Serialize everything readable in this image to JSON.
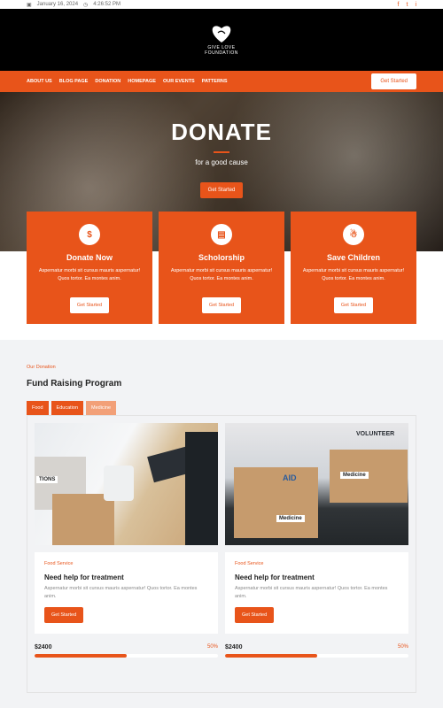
{
  "topbar": {
    "date": "January 16, 2024",
    "time": "4:26:52 PM",
    "social": [
      "f",
      "t",
      "i"
    ]
  },
  "brand": {
    "name": "GIVE LOVE",
    "tagline": "FOUNDATION"
  },
  "nav": {
    "items": [
      "ABOUT US",
      "BLOG PAGE",
      "DONATION",
      "HOMEPAGE",
      "OUR EVENTS",
      "PATTERNS"
    ],
    "cta": "Get Started"
  },
  "hero": {
    "title": "DONATE",
    "subtitle": "for a good cause",
    "cta": "Get Started"
  },
  "features": [
    {
      "icon": "$",
      "title": "Donate Now",
      "text": "Aspernatur morbi sit cursus mauris aspernatur! Quos tortor. Ea montes anim.",
      "cta": "Get Started"
    },
    {
      "icon": "▤",
      "title": "Scholorship",
      "text": "Aspernatur morbi sit cursus mauris aspernatur! Quos tortor. Ea montes anim.",
      "cta": "Get Started"
    },
    {
      "icon": "☃",
      "title": "Save Children",
      "text": "Aspernatur morbi sit cursus mauris aspernatur! Quos tortor. Ea montes anim.",
      "cta": "Get Started"
    }
  ],
  "fundraising": {
    "eyebrow": "Our Donation",
    "title": "Fund Raising Program",
    "tabs": [
      "Food",
      "Education",
      "Medicine"
    ],
    "items": [
      {
        "category": "Food Service",
        "title": "Need help for treatment",
        "text": "Aspernatur morbi sit cursus mauris aspernatur! Quos tortor. Ea montes anim.",
        "cta": "Get Started",
        "amount": "$2400",
        "percent": "50%",
        "progress": 0.5,
        "photo_labels": [
          "TIONS"
        ]
      },
      {
        "category": "Food Service",
        "title": "Need help for treatment",
        "text": "Aspernatur morbi sit cursus mauris aspernatur! Quos tortor. Ea montes anim.",
        "cta": "Get Started",
        "amount": "$2400",
        "percent": "50%",
        "progress": 0.5,
        "photo_labels": [
          "VOLUNTEER",
          "AID",
          "Medicine",
          "Medicine"
        ]
      }
    ]
  },
  "colors": {
    "accent": "#e8541a",
    "header_bg": "#000000"
  }
}
